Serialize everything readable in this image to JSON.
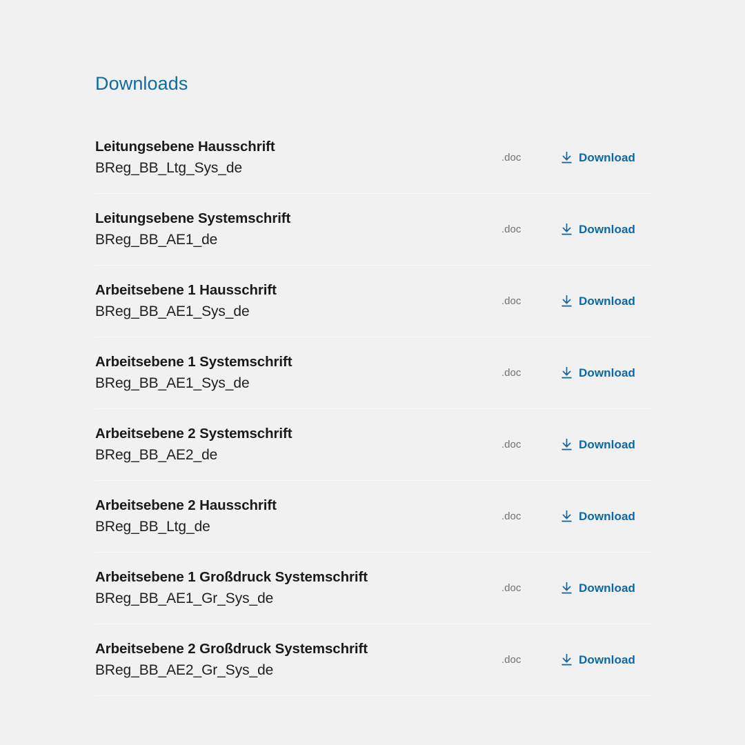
{
  "section": {
    "title": "Downloads",
    "title_color": "#0d6ba5",
    "link_color": "#0a67a8",
    "background_color": "#f1f1f1",
    "extension_color": "#6f7276",
    "separator_color": "#f7f7f7",
    "download_icon_name": "download-arrow-icon"
  },
  "downloads": [
    {
      "title": "Leitungsebene Hausschrift",
      "filename": "BReg_BB_Ltg_Sys_de",
      "extension": ".doc",
      "action_label": "Download"
    },
    {
      "title": "Leitungsebene Systemschrift",
      "filename": "BReg_BB_AE1_de",
      "extension": ".doc",
      "action_label": "Download"
    },
    {
      "title": "Arbeitsebene 1 Hausschrift",
      "filename": "BReg_BB_AE1_Sys_de",
      "extension": ".doc",
      "action_label": "Download"
    },
    {
      "title": "Arbeitsebene 1 Systemschrift",
      "filename": "BReg_BB_AE1_Sys_de",
      "extension": ".doc",
      "action_label": "Download"
    },
    {
      "title": "Arbeitsebene 2 Systemschrift",
      "filename": "BReg_BB_AE2_de",
      "extension": ".doc",
      "action_label": "Download"
    },
    {
      "title": "Arbeitsebene 2 Hausschrift",
      "filename": "BReg_BB_Ltg_de",
      "extension": ".doc",
      "action_label": "Download"
    },
    {
      "title": "Arbeitsebene 1 Großdruck Systemschrift",
      "filename": "BReg_BB_AE1_Gr_Sys_de",
      "extension": ".doc",
      "action_label": "Download"
    },
    {
      "title": "Arbeitsebene 2 Großdruck Systemschrift",
      "filename": "BReg_BB_AE2_Gr_Sys_de",
      "extension": ".doc",
      "action_label": "Download"
    }
  ]
}
